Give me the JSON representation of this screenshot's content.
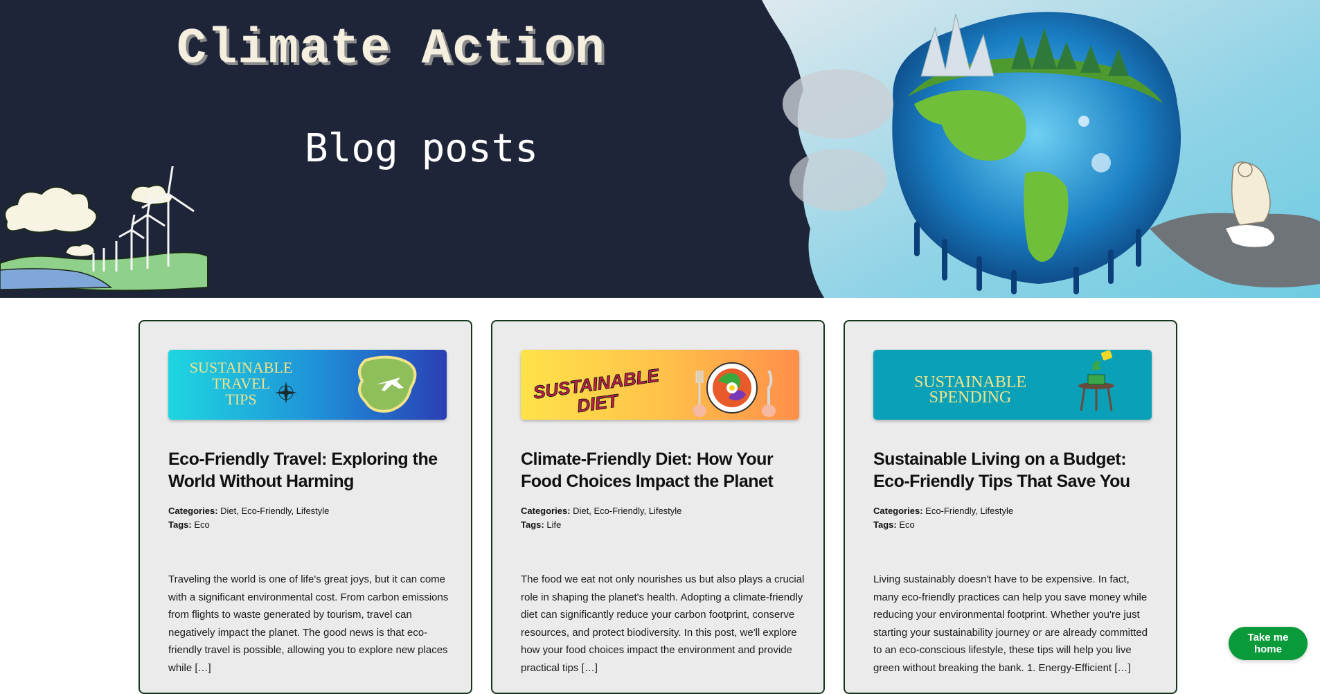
{
  "header": {
    "title": "Climate Action",
    "subtitle": "Blog posts"
  },
  "posts": [
    {
      "thumb_text": [
        "SUSTAINABLE",
        "TRAVEL",
        "TIPS"
      ],
      "title": "Eco-Friendly Travel: Exploring the World Without Harming",
      "categories_label": "Categories:",
      "categories": "Diet, Eco-Friendly, Lifestyle",
      "tags_label": "Tags:",
      "tags": "Eco",
      "excerpt": "Traveling the world is one of life's great joys, but it can come with a significant environmental cost. From carbon emissions from flights to waste generated by tourism, travel can negatively impact the planet. The good news is that eco-friendly travel is possible, allowing you to explore new places while […]"
    },
    {
      "thumb_text": [
        "SUSTAINABLE",
        "DIET"
      ],
      "title": "Climate-Friendly Diet: How Your Food Choices Impact the Planet",
      "categories_label": "Categories:",
      "categories": "Diet, Eco-Friendly, Lifestyle",
      "tags_label": "Tags:",
      "tags": "Life",
      "excerpt": "The food we eat not only nourishes us but also plays a crucial role in shaping the planet's health. Adopting a climate-friendly diet can significantly reduce your carbon footprint, conserve resources, and protect biodiversity. In this post, we'll explore how your food choices impact the environment and provide practical tips […]"
    },
    {
      "thumb_text": [
        "SUSTAINABLE",
        "SPENDING"
      ],
      "title": "Sustainable Living on a Budget: Eco-Friendly Tips That Save You",
      "categories_label": "Categories:",
      "categories": "Eco-Friendly, Lifestyle",
      "tags_label": "Tags:",
      "tags": "Eco",
      "excerpt": "Living sustainably doesn't have to be expensive. In fact, many eco-friendly practices can help you save money while reducing your environmental footprint. Whether you're just starting your sustainability journey or are already committed to an eco-conscious lifestyle, these tips will help you live green without breaking the bank. 1. Energy-Efficient […]"
    }
  ],
  "home_button": "Take me home",
  "colors": {
    "hero_bg": "#1f2538",
    "card_bg": "#ebebeb",
    "card_border": "#14361c",
    "button_bg": "#0a9a3a"
  }
}
